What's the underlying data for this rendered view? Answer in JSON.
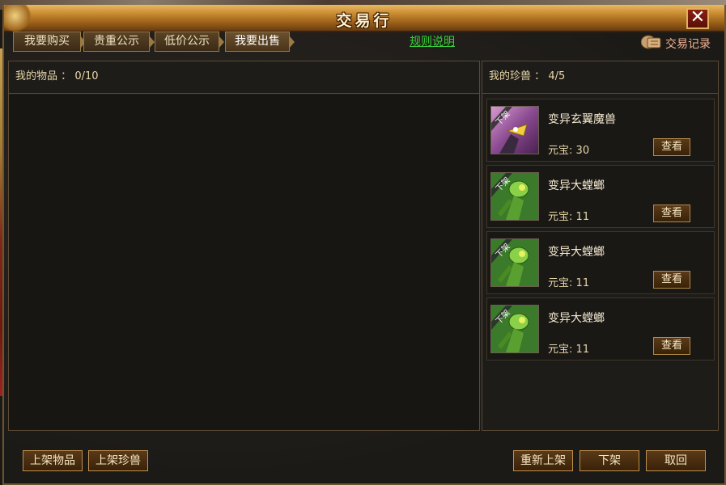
{
  "window": {
    "title": "交易行",
    "close_label": "✕"
  },
  "tabs": [
    {
      "label": "我要购买"
    },
    {
      "label": "贵重公示"
    },
    {
      "label": "低价公示"
    },
    {
      "label": "我要出售"
    }
  ],
  "rules_link": "规则说明",
  "record_link": "交易记录",
  "my_items": {
    "label": "我的物品",
    "count": "0/10"
  },
  "my_pets": {
    "label": "我的珍兽",
    "count": "4/5",
    "items": [
      {
        "badge": "下架",
        "name": "变异玄翼魔兽",
        "price_label": "元宝",
        "price": "30",
        "button": "查看",
        "icon": "black-bird-beast-icon"
      },
      {
        "badge": "下架",
        "name": "变异大螳螂",
        "price_label": "元宝",
        "price": "11",
        "button": "查看",
        "icon": "green-mantis-icon"
      },
      {
        "badge": "下架",
        "name": "变异大螳螂",
        "price_label": "元宝",
        "price": "11",
        "button": "查看",
        "icon": "green-mantis-icon"
      },
      {
        "badge": "下架",
        "name": "变异大螳螂",
        "price_label": "元宝",
        "price": "11",
        "button": "查看",
        "icon": "green-mantis-icon"
      }
    ]
  },
  "bottom_buttons": {
    "list_item": "上架物品",
    "list_pet": "上架珍兽",
    "relist": "重新上架",
    "delist": "下架",
    "cancel": "取回"
  },
  "colors": {
    "title_gold": "#c88a30",
    "link_green": "#38d038",
    "record_pink": "#f0b090",
    "panel_border": "#5a4a36"
  }
}
